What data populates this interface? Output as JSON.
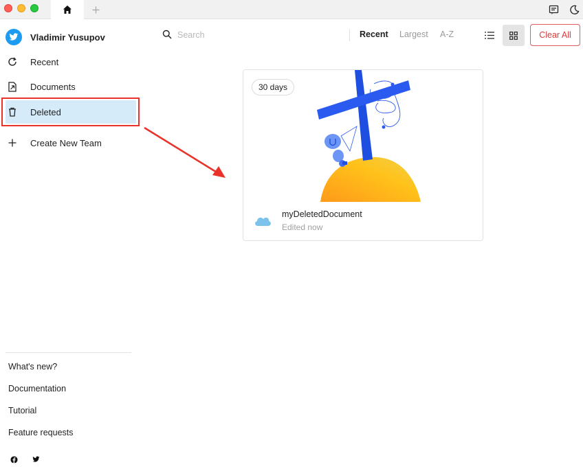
{
  "user": {
    "name": "Vladimir Yusupov"
  },
  "sidebar": {
    "items": [
      {
        "label": "Recent",
        "icon": "refresh-icon"
      },
      {
        "label": "Documents",
        "icon": "document-icon"
      },
      {
        "label": "Deleted",
        "icon": "trash-icon",
        "active": true
      },
      {
        "label": "Create New Team",
        "icon": "plus-icon"
      }
    ],
    "footer": [
      {
        "label": "What's new?"
      },
      {
        "label": "Documentation"
      },
      {
        "label": "Tutorial"
      },
      {
        "label": "Feature requests"
      }
    ],
    "social": [
      "facebook-icon",
      "twitter-icon"
    ]
  },
  "search": {
    "placeholder": "Search",
    "value": ""
  },
  "sort": {
    "options": [
      "Recent",
      "Largest",
      "A-Z"
    ],
    "selected": "Recent"
  },
  "view": {
    "mode": "grid"
  },
  "actions": {
    "clear_all": "Clear All"
  },
  "documents": [
    {
      "name": "myDeletedDocument",
      "time": "Edited now",
      "days_left": "30 days",
      "storage": "cloud-icon"
    }
  ],
  "colors": {
    "accent": "#1d9bf0",
    "active_bg": "#d5ebfa",
    "danger": "#d93b3b",
    "annotation": "#e8322a"
  }
}
